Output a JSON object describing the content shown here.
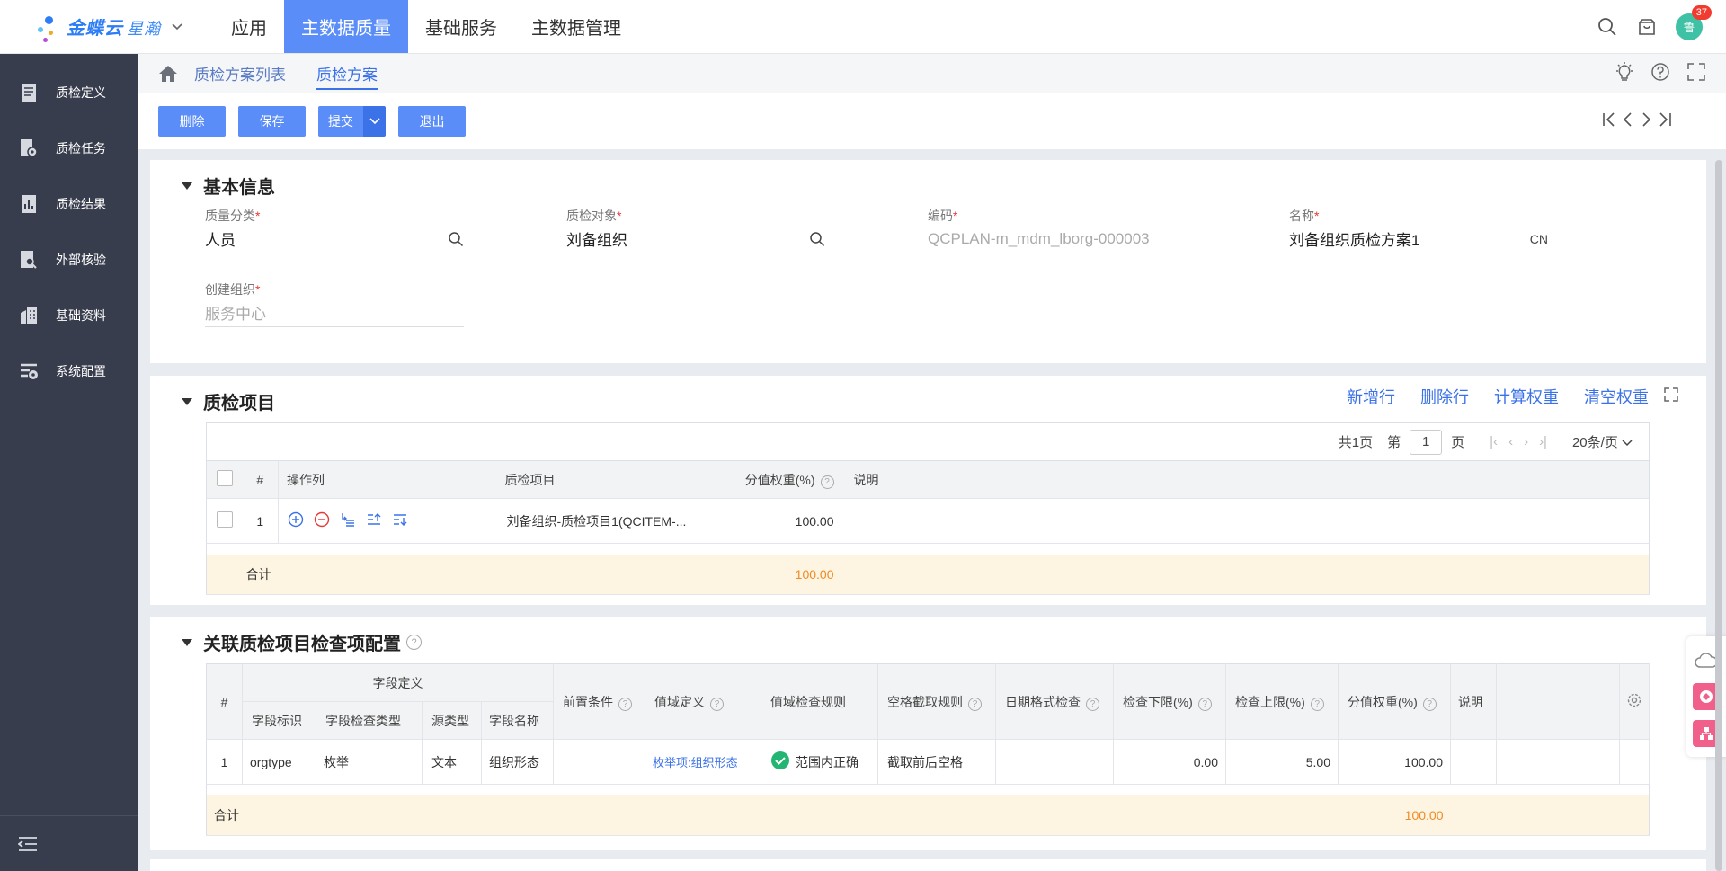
{
  "header": {
    "logo_text": "金蝶云",
    "logo_sub": "星瀚",
    "nav": [
      "应用",
      "主数据质量",
      "基础服务",
      "主数据管理"
    ],
    "nav_active": 1,
    "badge_count": "37",
    "avatar_text": "鲁"
  },
  "sidebar": {
    "items": [
      {
        "label": "质检定义",
        "icon": "document-icon"
      },
      {
        "label": "质检任务",
        "icon": "task-gear-icon"
      },
      {
        "label": "质检结果",
        "icon": "chart-doc-icon"
      },
      {
        "label": "外部核验",
        "icon": "search-doc-icon"
      },
      {
        "label": "基础资料",
        "icon": "building-icon"
      },
      {
        "label": "系统配置",
        "icon": "settings-list-icon"
      }
    ]
  },
  "tabs": [
    "质检方案列表",
    "质检方案"
  ],
  "toolbar": {
    "delete": "删除",
    "save": "保存",
    "submit": "提交",
    "exit": "退出"
  },
  "basic": {
    "title": "基本信息",
    "fields": [
      {
        "label": "质量分类",
        "value": "人员"
      },
      {
        "label": "质检对象",
        "value": "刘备组织"
      },
      {
        "label": "编码",
        "value": "QCPLAN-m_mdm_lborg-000003"
      },
      {
        "label": "名称",
        "value": "刘备组织质检方案1",
        "suffix": "CN"
      },
      {
        "label": "创建组织",
        "value": "服务中心"
      }
    ]
  },
  "items": {
    "title": "质检项目",
    "actions": [
      "新增行",
      "删除行",
      "计算权重",
      "清空权重"
    ],
    "pager": {
      "total": "共1页",
      "pre": "第",
      "page": "1",
      "post": "页",
      "size": "20条/页"
    },
    "columns": [
      "#",
      "操作列",
      "质检项目",
      "分值权重(%)",
      "说明"
    ],
    "rows": [
      {
        "no": "1",
        "item": "刘备组织-质检项目1(QCITEM-...",
        "weight": "100.00",
        "desc": ""
      }
    ],
    "sum_label": "合计",
    "sum_weight": "100.00"
  },
  "config": {
    "title": "关联质检项目检查项配置",
    "group_header": "字段定义",
    "columns": {
      "no": "#",
      "field_id": "字段标识",
      "check_type": "字段检查类型",
      "src_type": "源类型",
      "field_name": "字段名称",
      "precond": "前置条件",
      "domain_def": "值域定义",
      "domain_rule": "值域检查规则",
      "blank_rule": "空格截取规则",
      "date_check": "日期格式检查",
      "lower": "检查下限(%)",
      "upper": "检查上限(%)",
      "weight": "分值权重(%)",
      "desc": "说明"
    },
    "rows": [
      {
        "no": "1",
        "field_id": "orgtype",
        "check_type": "枚举",
        "src_type": "文本",
        "field_name": "组织形态",
        "precond": "",
        "domain_def": "枚举项:组织形态",
        "domain_rule": "范围内正确",
        "blank_rule": "截取前后空格",
        "date_check": "",
        "lower": "0.00",
        "upper": "5.00",
        "weight": "100.00",
        "desc": ""
      }
    ],
    "sum_label": "合计",
    "sum_weight": "100.00"
  },
  "colors": {
    "accent": "#5a8df8",
    "sidebar": "#383d4d",
    "sum_bg": "#fdf5e1",
    "orange": "#f08a24"
  }
}
